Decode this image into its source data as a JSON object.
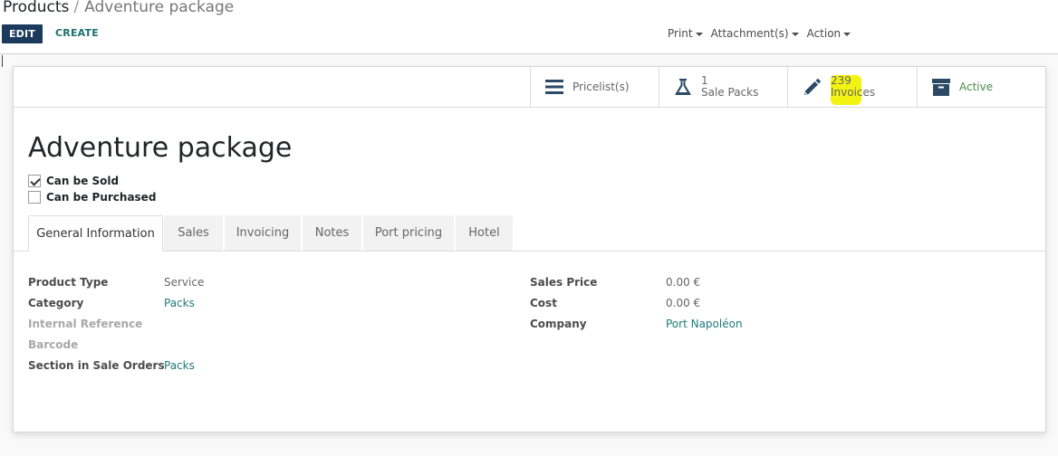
{
  "breadcrumb": {
    "parent": "Products",
    "separator": "/",
    "current": "Adventure package"
  },
  "toolbar": {
    "edit_label": "EDIT",
    "create_label": "CREATE",
    "print_label": "Print",
    "attachments_label": "Attachment(s)",
    "action_label": "Action"
  },
  "stat_buttons": {
    "pricelists": {
      "label": "Pricelist(s)",
      "icon": "list-icon"
    },
    "sale_packs": {
      "count": "1",
      "label": "Sale Packs",
      "icon": "flask-icon"
    },
    "invoices": {
      "count": "239",
      "label": "Invoices",
      "icon": "pencil-icon"
    },
    "active": {
      "label": "Active",
      "icon": "archive-icon",
      "color": "#4c8a4c"
    }
  },
  "product": {
    "name": "Adventure package",
    "can_be_sold": {
      "label": "Can be Sold",
      "checked": true
    },
    "can_be_purchased": {
      "label": "Can be Purchased",
      "checked": false
    }
  },
  "tabs": [
    {
      "label": "General Information",
      "active": true
    },
    {
      "label": "Sales"
    },
    {
      "label": "Invoicing"
    },
    {
      "label": "Notes"
    },
    {
      "label": "Port pricing"
    },
    {
      "label": "Hotel"
    }
  ],
  "fields_left": [
    {
      "label": "Product Type",
      "value": "Service"
    },
    {
      "label": "Category",
      "value": "Packs"
    },
    {
      "label": "Internal Reference",
      "value": ""
    },
    {
      "label": "Barcode",
      "value": ""
    },
    {
      "label": "Section in Sale Orders",
      "value": "Packs"
    }
  ],
  "fields_right": [
    {
      "label": "Sales Price",
      "value": "0.00 €"
    },
    {
      "label": "Cost",
      "value": "0.00 €"
    },
    {
      "label": "Company",
      "value": "Port Napoléon"
    }
  ],
  "colors": {
    "primary": "#1b3a5c",
    "link": "#1f7a7a",
    "highlight": "#f3f312"
  }
}
